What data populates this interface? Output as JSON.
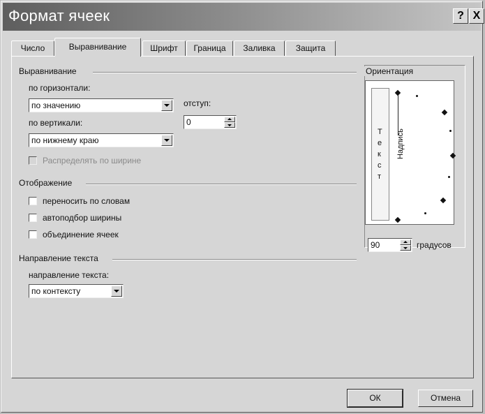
{
  "window": {
    "title": "Формат ячеек",
    "help_button": "?",
    "close_button": "X"
  },
  "tabs": [
    {
      "label": "Число"
    },
    {
      "label": "Выравнивание"
    },
    {
      "label": "Шрифт"
    },
    {
      "label": "Граница"
    },
    {
      "label": "Заливка"
    },
    {
      "label": "Защита"
    }
  ],
  "alignment": {
    "group_label": "Выравнивание",
    "horizontal_label": "по горизонтали:",
    "horizontal_value": "по значению",
    "indent_label": "отступ:",
    "indent_value": "0",
    "vertical_label": "по вертикали:",
    "vertical_value": "по нижнему краю",
    "distribute_label": "Распределять по ширине"
  },
  "display": {
    "group_label": "Отображение",
    "wrap_text": "переносить по словам",
    "shrink_to_fit": "автоподбор ширины",
    "merge_cells": "объединение ячеек"
  },
  "text_direction": {
    "group_label": "Направление текста",
    "direction_label": "направление текста:",
    "direction_value": "по контексту"
  },
  "orientation": {
    "group_label": "Ориентация",
    "vertical_text": [
      "Т",
      "е",
      "к",
      "с",
      "т"
    ],
    "dial_text": "Надпись",
    "degrees_value": "90",
    "degrees_label": "градусов"
  },
  "buttons": {
    "ok": "ОК",
    "cancel": "Отмена"
  }
}
